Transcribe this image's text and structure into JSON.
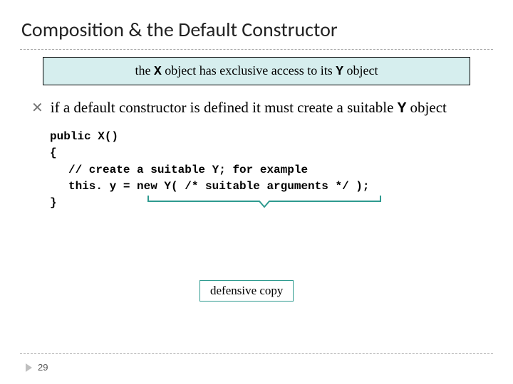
{
  "title": "Composition & the Default Constructor",
  "callout": {
    "pre": "the ",
    "code1": "X",
    "mid": " object has exclusive access to its ",
    "code2": "Y",
    "post": " object"
  },
  "bullet": {
    "pre": "if a default constructor is defined it must create a suitable ",
    "code": "Y",
    "post": " object"
  },
  "code": {
    "l1": "public X()",
    "l2": "{",
    "l3": "// create a suitable Y; for example",
    "l4": "this. y = new Y( /* suitable arguments */ );",
    "l5": "}"
  },
  "annotation": "defensive copy",
  "pageNumber": "29"
}
